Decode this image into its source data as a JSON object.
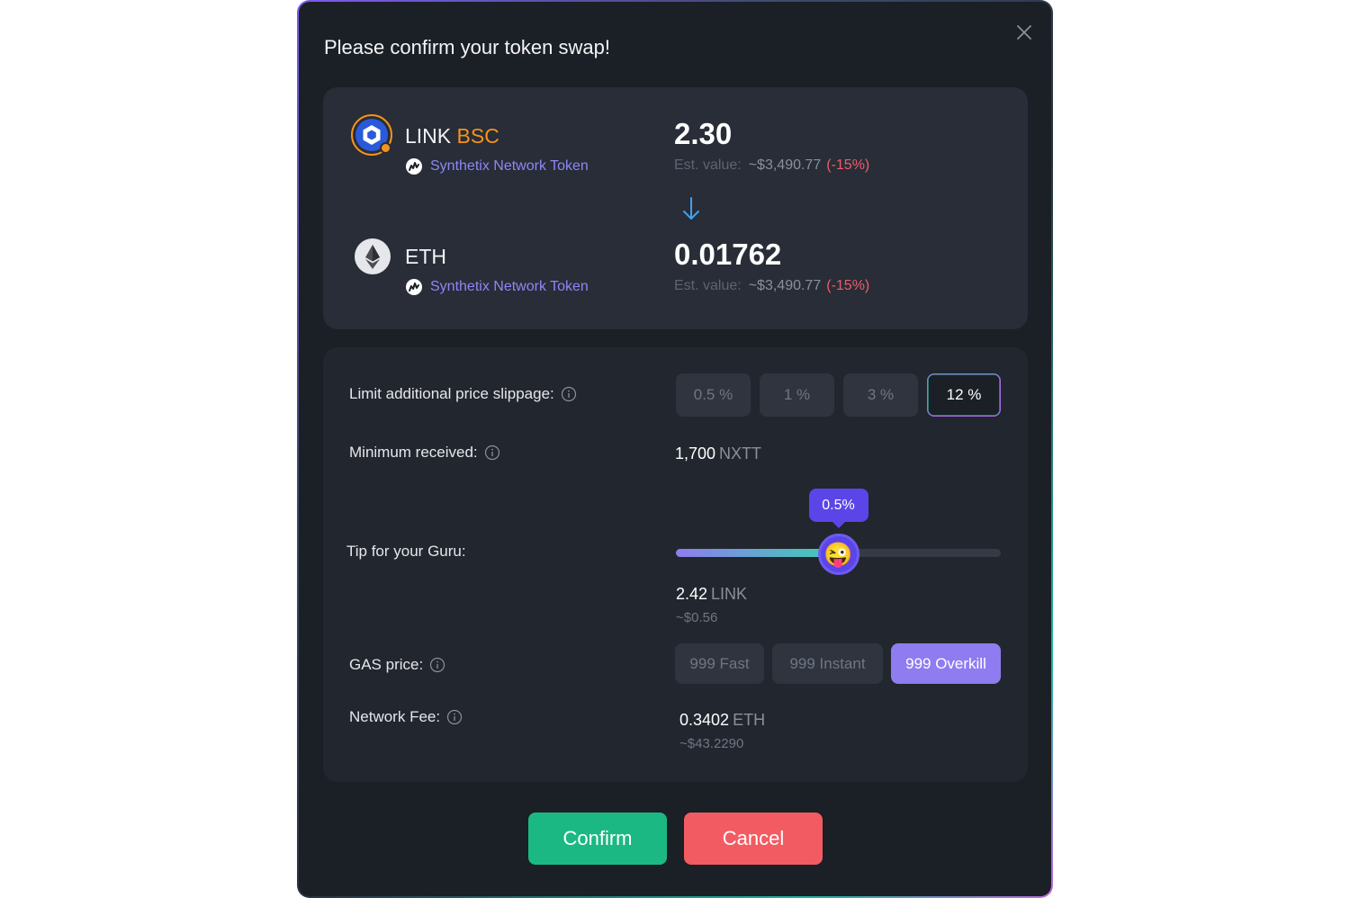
{
  "modal": {
    "title": "Please confirm your token swap!",
    "close_icon": "close-icon"
  },
  "from": {
    "symbol": "LINK",
    "network": "BSC",
    "name": "Synthetix Network Token",
    "amount": "2.30",
    "est_label": "Est. value:",
    "est_value": "~$3,490.77",
    "est_change": "(-15%)"
  },
  "to": {
    "symbol": "ETH",
    "name": "Synthetix Network Token",
    "amount": "0.01762",
    "est_label": "Est. value:",
    "est_value": "~$3,490.77",
    "est_change": "(-15%)"
  },
  "slippage": {
    "label": "Limit additional price slippage:",
    "options": [
      "0.5 %",
      "1 %",
      "3 %",
      "12 %"
    ],
    "selected": "12 %"
  },
  "minimum": {
    "label": "Minimum received:",
    "value": "1,700",
    "unit": "NXTT"
  },
  "tip": {
    "label": "Tip for your Guru:",
    "tooltip": "0.5%",
    "level_fraction": 0.5,
    "emoji": "😜",
    "amount": "2.42",
    "unit": "LINK",
    "usd": "~$0.56"
  },
  "gas": {
    "label": "GAS price:",
    "options": [
      "999 Fast",
      "999 Instant",
      "999 Overkill"
    ],
    "selected": "999 Overkill"
  },
  "network_fee": {
    "label": "Network Fee:",
    "value": "0.3402",
    "unit": "ETH",
    "usd": "~$43.2290"
  },
  "actions": {
    "confirm": "Confirm",
    "cancel": "Cancel"
  },
  "colors": {
    "confirm": "#1cb884",
    "cancel": "#f35b62",
    "accent": "#5b45e8",
    "network": "#f7931a",
    "negative": "#f25a6a"
  }
}
